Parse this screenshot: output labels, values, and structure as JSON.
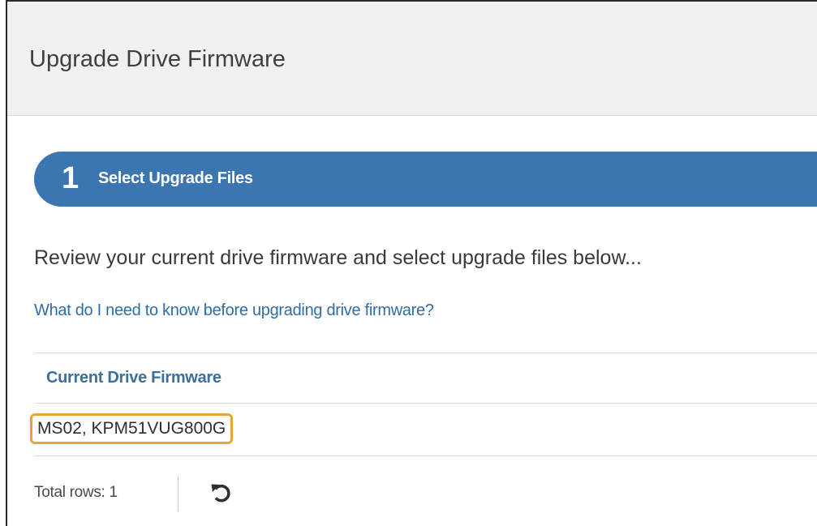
{
  "dialog": {
    "title": "Upgrade Drive Firmware"
  },
  "step": {
    "number": "1",
    "label": "Select Upgrade Files",
    "color": "#3c76b1"
  },
  "intro_text": "Review your current drive firmware and select upgrade files below...",
  "help_link": "What do I need to know before upgrading drive firmware?",
  "table": {
    "columns": [
      "Current Drive Firmware"
    ],
    "rows": [
      [
        "MS02, KPM51VUG800G"
      ]
    ],
    "highlight_color": "#e8a33b"
  },
  "footer": {
    "total_rows": "Total rows: 1",
    "refresh_icon": "refresh-icon"
  }
}
